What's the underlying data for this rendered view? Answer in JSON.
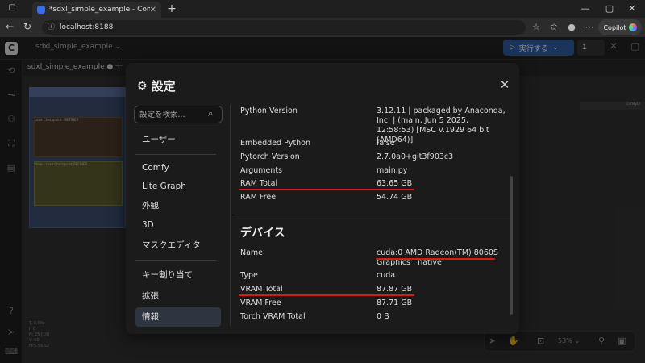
{
  "browser": {
    "tab_title": "*sdxl_simple_example - ComfyUI",
    "url": "localhost:8188",
    "copilot_label": "Copilot"
  },
  "app": {
    "workflow_name": "sdxl_simple_example",
    "workflow_tab": "sdxl_simple_example",
    "run_label": "実行する",
    "run_count": "1",
    "zoom": "53%",
    "node1_title": "Load Checkpoint - REFINER",
    "node2_title": "Note - Load Checkpoint REFINER",
    "stats": [
      "T: 0.00s",
      "I: 0",
      "N: 25 [10]",
      "V: 60",
      "FPS:59.52"
    ],
    "right_label": "ComfyUI"
  },
  "dialog": {
    "title": "設定",
    "search_placeholder": "設定を検索...",
    "nav": [
      {
        "label": "ユーザー",
        "active": false
      },
      {
        "label": "Comfy",
        "active": false
      },
      {
        "label": "Lite Graph",
        "active": false
      },
      {
        "label": "外観",
        "active": false
      },
      {
        "label": "3D",
        "active": false
      },
      {
        "label": "マスクエディタ",
        "active": false
      },
      {
        "label": "キー割り当て",
        "active": false
      },
      {
        "label": "拡張",
        "active": false
      },
      {
        "label": "情報",
        "active": true
      }
    ],
    "system": [
      {
        "label": "Python Version",
        "value": "3.12.11 | packaged by Anaconda, Inc. | (main, Jun 5 2025, 12:58:53) [MSC v.1929 64 bit (AMD64)]"
      },
      {
        "label": "Embedded Python",
        "value": "false"
      },
      {
        "label": "Pytorch Version",
        "value": "2.7.0a0+git3f903c3"
      },
      {
        "label": "Arguments",
        "value": "main.py"
      },
      {
        "label": "RAM Total",
        "value": "63.65 GB"
      },
      {
        "label": "RAM Free",
        "value": "54.74 GB"
      }
    ],
    "devices_heading": "デバイス",
    "devices": [
      {
        "label": "Name",
        "value": "cuda:0 AMD Radeon(TM) 8060S Graphics : native"
      },
      {
        "label": "Type",
        "value": "cuda"
      },
      {
        "label": "VRAM Total",
        "value": "87.87 GB"
      },
      {
        "label": "VRAM Free",
        "value": "87.71 GB"
      },
      {
        "label": "Torch VRAM Total",
        "value": "0 B"
      }
    ],
    "highlight_color": "#d21b1b"
  }
}
